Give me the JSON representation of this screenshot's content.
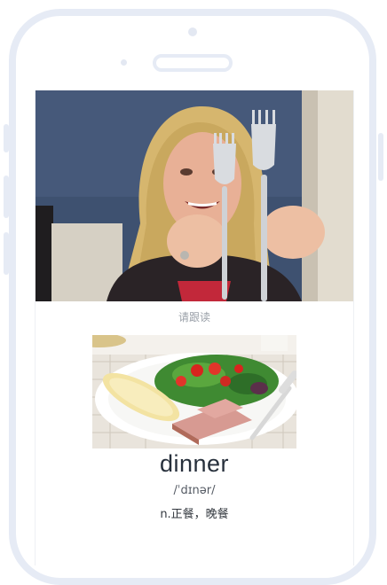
{
  "lesson": {
    "prompt": "请跟读",
    "word": "dinner",
    "phonetic": "/ˈdɪnər/",
    "meaning": "n.正餐，晚餐"
  },
  "colors": {
    "frame": "#e6ebf5",
    "word_text": "#27303c",
    "prompt_text": "#9aa0a8"
  }
}
